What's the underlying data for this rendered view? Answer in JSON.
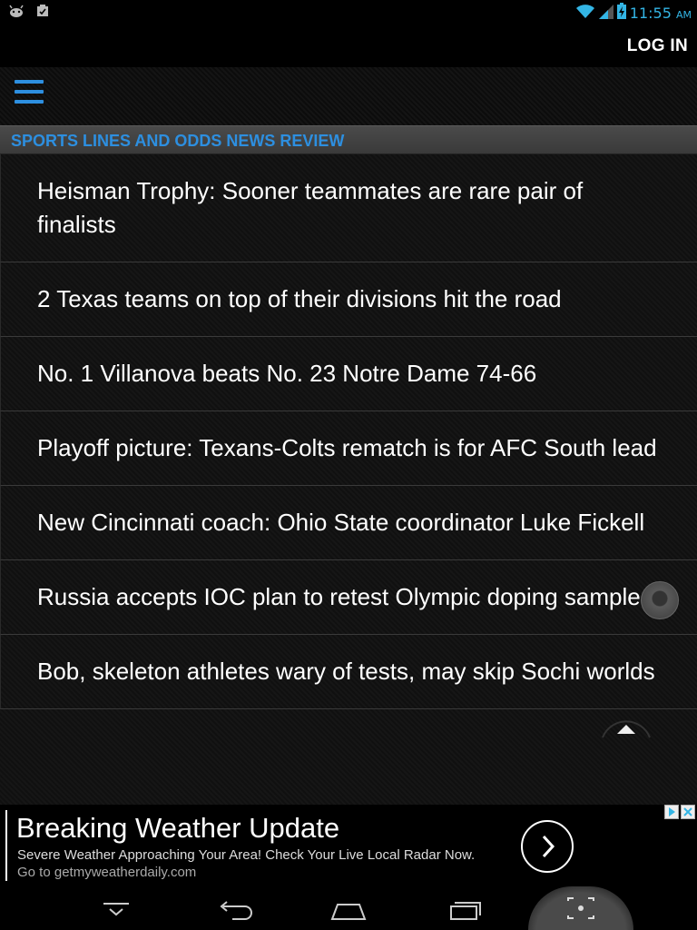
{
  "status_bar": {
    "time": "11:55",
    "ampm": "AM",
    "left_icons": [
      "android-debug-icon",
      "clipboard-icon"
    ],
    "right_icons": [
      "wifi-icon",
      "signal-icon",
      "battery-charging-icon"
    ],
    "accent_color": "#33b5e5"
  },
  "action_bar": {
    "login_label": "LOG IN"
  },
  "toolbar": {
    "menu_icon": "hamburger-menu-icon",
    "accent_color": "#2d8fe0"
  },
  "section": {
    "title": "SPORTS LINES AND ODDS NEWS REVIEW"
  },
  "news_items": [
    "Heisman Trophy: Sooner teammates are rare pair of finalists",
    "2 Texas teams on top of their divisions hit the road",
    "No. 1 Villanova beats No. 23 Notre Dame 74-66",
    "Playoff picture: Texans-Colts rematch is for AFC South lead",
    "New Cincinnati coach: Ohio State coordinator Luke Fickell",
    "Russia accepts IOC plan to retest Olympic doping samples",
    "Bob, skeleton athletes wary of tests, may skip Sochi worlds"
  ],
  "ad": {
    "title": "Breaking Weather Update",
    "text": "Severe Weather Approaching Your Area! Check Your Live Local Radar Now.",
    "url": "Go to getmyweatherdaily.com"
  },
  "nav_bar": {
    "icons": [
      "hide-keyboard-icon",
      "back-icon",
      "home-icon",
      "recent-apps-icon",
      "screenshot-icon"
    ]
  }
}
